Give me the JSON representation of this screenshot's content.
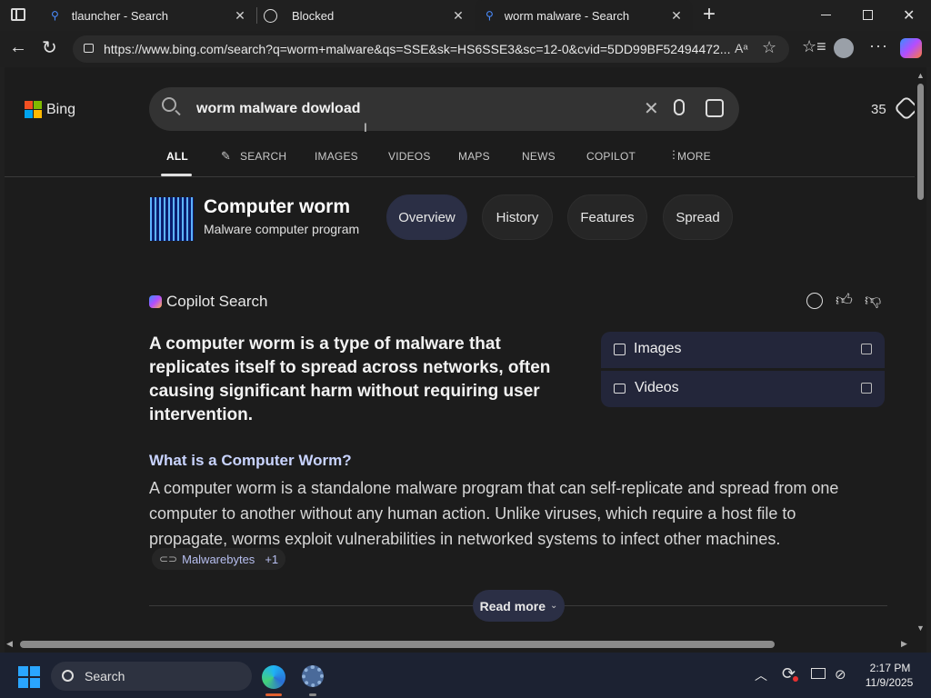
{
  "browser": {
    "tabs": [
      {
        "title": "tlauncher - Search",
        "close": "✕"
      },
      {
        "title": "Blocked",
        "close": "✕"
      },
      {
        "title": "worm malware - Search",
        "close": "✕"
      }
    ],
    "new_tab": "+",
    "url": "https://www.bing.com/search?q=worm+malware&qs=SSE&sk=HS6SSE3&sc=12-0&cvid=5DD99BF52494472..."
  },
  "bing": {
    "logo_text": "Bing",
    "query": "worm malware dowload",
    "rewards_count": "35",
    "nav": [
      "ALL",
      "SEARCH",
      "IMAGES",
      "VIDEOS",
      "MAPS",
      "NEWS",
      "COPILOT",
      "MORE"
    ]
  },
  "entity": {
    "title": "Computer worm",
    "subtitle": "Malware computer program",
    "pills": [
      "Overview",
      "History",
      "Features",
      "Spread"
    ]
  },
  "copilot": {
    "brand": "Copilot Search",
    "headline": "A computer worm is a type of malware that replicates itself to spread across networks, often causing significant harm without requiring user intervention.",
    "section_title": "What is a Computer Worm?",
    "body": "A computer worm is a standalone malware program that can self-replicate and spread from one computer to another without any human action. Unlike viruses, which require a host file to propagate, worms exploit vulnerabilities in networked systems to infect other machines.",
    "source": "Malwarebytes",
    "source_more": "+1",
    "read_more": "Read more",
    "side_links": [
      "Images",
      "Videos"
    ]
  },
  "taskbar": {
    "search_placeholder": "Search",
    "time": "2:17 PM",
    "date": "11/9/2025"
  },
  "colors": {
    "accent": "#4a7cff",
    "pill_active": "#2b2f45",
    "text_muted": "#c4c4c4"
  }
}
